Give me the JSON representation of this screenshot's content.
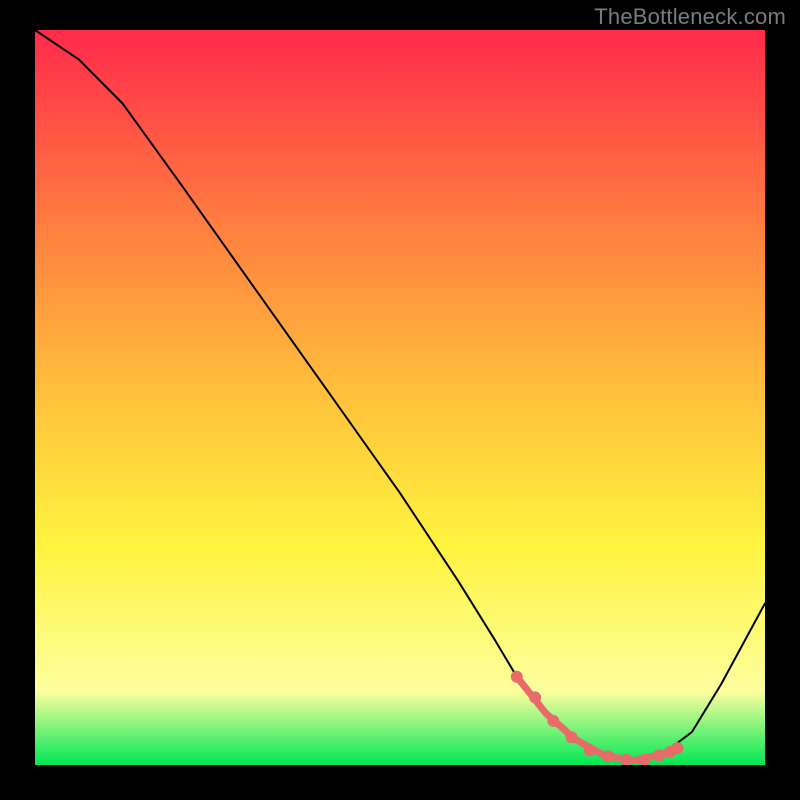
{
  "watermark": "TheBottleneck.com",
  "colors": {
    "bg": "#000000",
    "grad_top": "#ff2a4b",
    "grad_mid1": "#ff823f",
    "grad_mid2": "#ffc23c",
    "grad_mid3": "#fff33e",
    "grad_low": "#fdff9e",
    "grad_bottom": "#00e756",
    "curve": "#000000",
    "highlight": "#e86b6a"
  },
  "chart_data": {
    "type": "line",
    "title": "",
    "xlabel": "",
    "ylabel": "",
    "xlim": [
      0,
      100
    ],
    "ylim": [
      0,
      100
    ],
    "series": [
      {
        "name": "curve",
        "x": [
          0,
          6,
          12,
          20,
          30,
          40,
          50,
          58,
          63,
          66,
          70,
          74,
          78,
          82,
          86,
          90,
          94,
          100
        ],
        "values": [
          100,
          96,
          90,
          79,
          65,
          51,
          37,
          25,
          17,
          12,
          7,
          3.5,
          1.3,
          0.6,
          1.5,
          4.5,
          11,
          22
        ]
      },
      {
        "name": "highlight_segment",
        "x": [
          66,
          70,
          74,
          78,
          82,
          86,
          88
        ],
        "values": [
          12,
          7,
          3.5,
          1.3,
          0.6,
          1.5,
          2.3
        ]
      }
    ],
    "highlight_dots": {
      "x": [
        66,
        68.5,
        71,
        73.5,
        76,
        78.5,
        81,
        83.5,
        85.5,
        87.0,
        88.0
      ],
      "values": [
        12,
        9.2,
        6.0,
        3.8,
        2.0,
        1.2,
        0.7,
        0.7,
        1.3,
        1.8,
        2.3
      ]
    }
  }
}
